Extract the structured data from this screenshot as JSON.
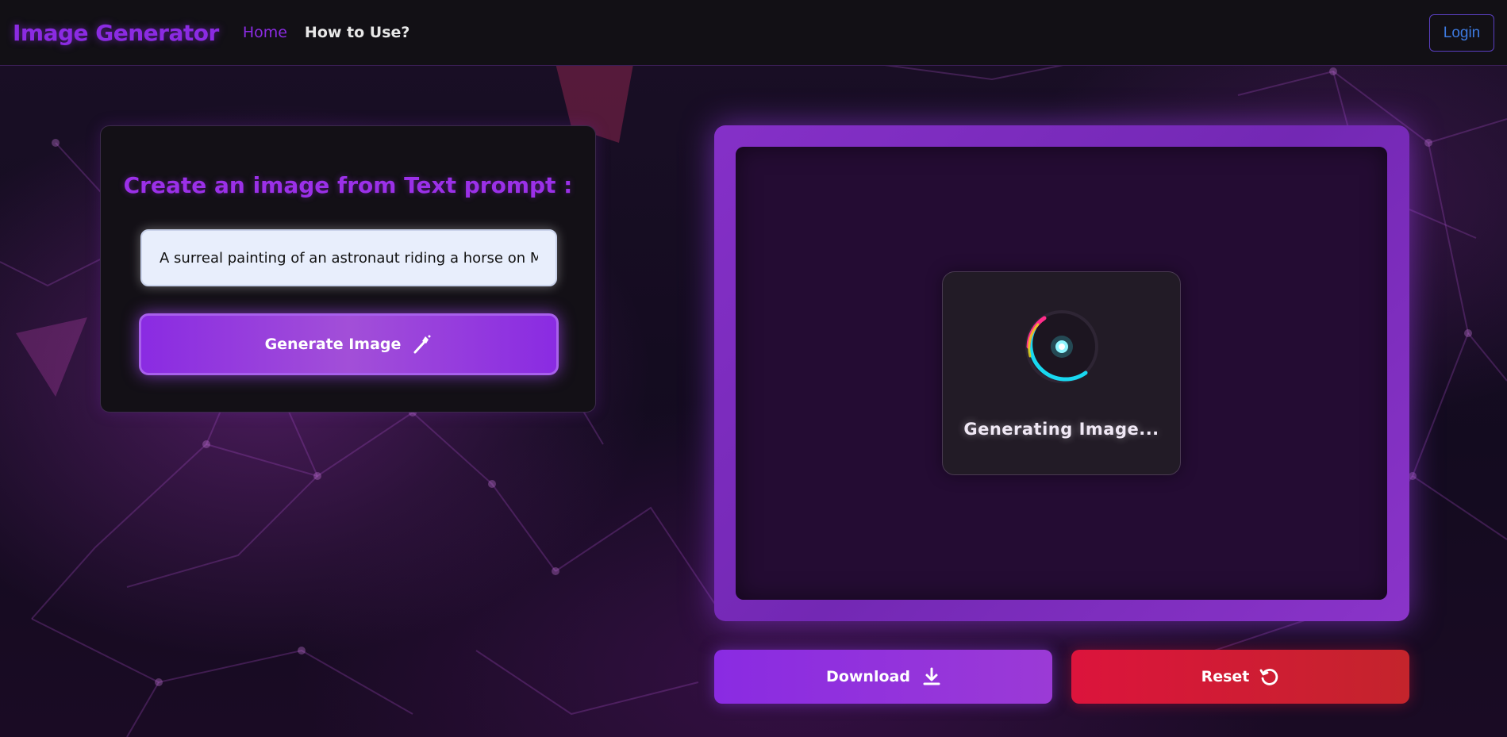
{
  "navbar": {
    "brand": "Image Generator",
    "links": [
      {
        "label": "Home",
        "active": true
      },
      {
        "label": "How to Use?",
        "active": false
      }
    ],
    "login_label": "Login"
  },
  "prompt_card": {
    "title": "Create an image from Text prompt :",
    "input_value": "A surreal painting of an astronaut riding a horse on Mars",
    "generate_label": "Generate Image",
    "generate_icon": "magic-wand-icon"
  },
  "preview": {
    "status": "Generating Image...",
    "spinner_icon": "loading-spinner-icon"
  },
  "actions": {
    "download_label": "Download",
    "download_icon": "download-icon",
    "reset_label": "Reset",
    "reset_icon": "reset-icon"
  },
  "colors": {
    "accent": "#8a2be2",
    "reset": "#dc143c",
    "login": "#3d7ae0"
  }
}
